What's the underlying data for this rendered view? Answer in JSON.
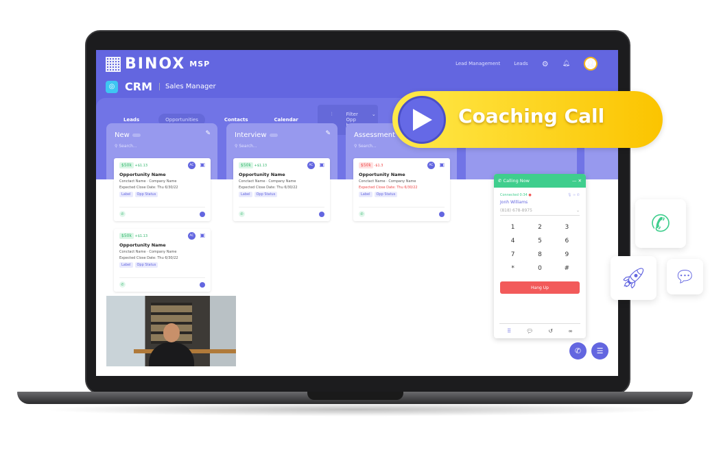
{
  "brand": {
    "name": "BINOX",
    "suffix": "MSP"
  },
  "topnav": {
    "items": [
      "Lead Management",
      "Leads"
    ]
  },
  "app": {
    "title": "CRM",
    "subtitle": "Sales Manager"
  },
  "tabs": [
    {
      "label": "Leads"
    },
    {
      "label": "Opportunities",
      "active": true
    },
    {
      "label": "Contacts"
    },
    {
      "label": "Calendar"
    }
  ],
  "filter": {
    "label": "Filter Opp by"
  },
  "columns": [
    {
      "title": "New",
      "search_placeholder": "Search...",
      "cards": [
        {
          "amount": "$50k",
          "delta": "+$1.13",
          "trend": "up",
          "name": "Opportunity Name",
          "contact": "Conctact Name",
          "company": "Company Name",
          "close": "Expected Close Date: Thu 6/30/22",
          "overdue": false,
          "tags": [
            "Label",
            "Opp Status"
          ],
          "avatar": "AC"
        },
        {
          "amount": "$50k",
          "delta": "+$1.13",
          "trend": "up",
          "name": "Opportunity Name",
          "contact": "Conctact Name",
          "company": "Company Name",
          "close": "Expected Close Date: Thu 6/30/22",
          "overdue": false,
          "tags": [
            "Label",
            "Opp Status"
          ],
          "avatar": "AC"
        }
      ]
    },
    {
      "title": "Interview",
      "search_placeholder": "Search...",
      "cards": [
        {
          "amount": "$50k",
          "delta": "+$1.13",
          "trend": "up",
          "name": "Opportunity Name",
          "contact": "Conctact Name",
          "company": "Company Name",
          "close": "Expected Close Date: Thu 6/30/22",
          "overdue": false,
          "tags": [
            "Label",
            "Opp Status"
          ],
          "avatar": "AC"
        }
      ]
    },
    {
      "title": "Assessment",
      "search_placeholder": "Search...",
      "cards": [
        {
          "amount": "$50k",
          "delta": "-$1.3",
          "trend": "down",
          "name": "Opportunity Name",
          "contact": "Conctact Name",
          "company": "Company Name",
          "close": "Expected Close Date: Thu 6/30/22",
          "overdue": true,
          "tags": [
            "Label",
            "Opp Status"
          ],
          "avatar": "AC"
        }
      ]
    }
  ],
  "dialer": {
    "title": "Calling Now",
    "status": "Connected 0:34",
    "caller": "Jonh Williams",
    "phone": "(818) 678-8975",
    "keys": [
      "1",
      "2",
      "3",
      "4",
      "5",
      "6",
      "7",
      "8",
      "9",
      "*",
      "0",
      "#"
    ],
    "hangup": "Hang Up"
  },
  "coaching": {
    "label": "Coaching Call"
  },
  "colors": {
    "primary": "#6366e0",
    "success": "#3fce8d",
    "danger": "#f25a5a",
    "accent": "#fbc400"
  }
}
